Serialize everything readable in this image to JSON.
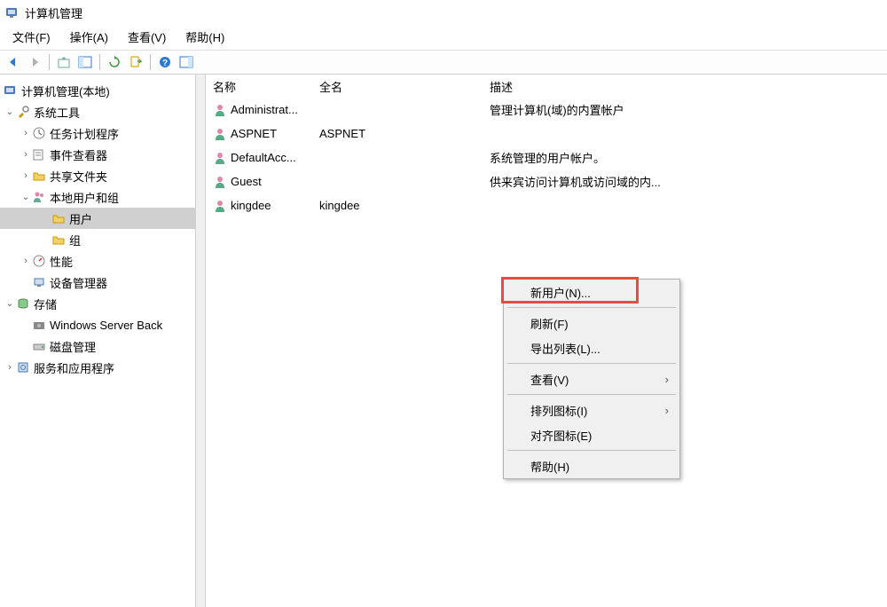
{
  "titlebar": {
    "title": "计算机管理"
  },
  "menubar": {
    "file": "文件(F)",
    "action": "操作(A)",
    "view": "查看(V)",
    "help": "帮助(H)"
  },
  "tree": {
    "root": "计算机管理(本地)",
    "system_tools": "系统工具",
    "task_scheduler": "任务计划程序",
    "event_viewer": "事件查看器",
    "shared_folders": "共享文件夹",
    "local_users": "本地用户和组",
    "users": "用户",
    "groups": "组",
    "performance": "性能",
    "device_manager": "设备管理器",
    "storage": "存储",
    "windows_backup": "Windows Server Back",
    "disk_management": "磁盘管理",
    "services_apps": "服务和应用程序"
  },
  "list": {
    "header": {
      "name": "名称",
      "fullname": "全名",
      "description": "描述"
    },
    "rows": [
      {
        "name": "Administrat...",
        "fullname": "",
        "description": "管理计算机(域)的内置帐户"
      },
      {
        "name": "ASPNET",
        "fullname": "ASPNET",
        "description": ""
      },
      {
        "name": "DefaultAcc...",
        "fullname": "",
        "description": "系统管理的用户帐户。"
      },
      {
        "name": "Guest",
        "fullname": "",
        "description": "供来宾访问计算机或访问域的内..."
      },
      {
        "name": "kingdee",
        "fullname": "kingdee",
        "description": ""
      }
    ]
  },
  "context": {
    "new_user": "新用户(N)...",
    "refresh": "刷新(F)",
    "export_list": "导出列表(L)...",
    "view": "查看(V)",
    "arrange_icons": "排列图标(I)",
    "align_icons": "对齐图标(E)",
    "help": "帮助(H)"
  }
}
